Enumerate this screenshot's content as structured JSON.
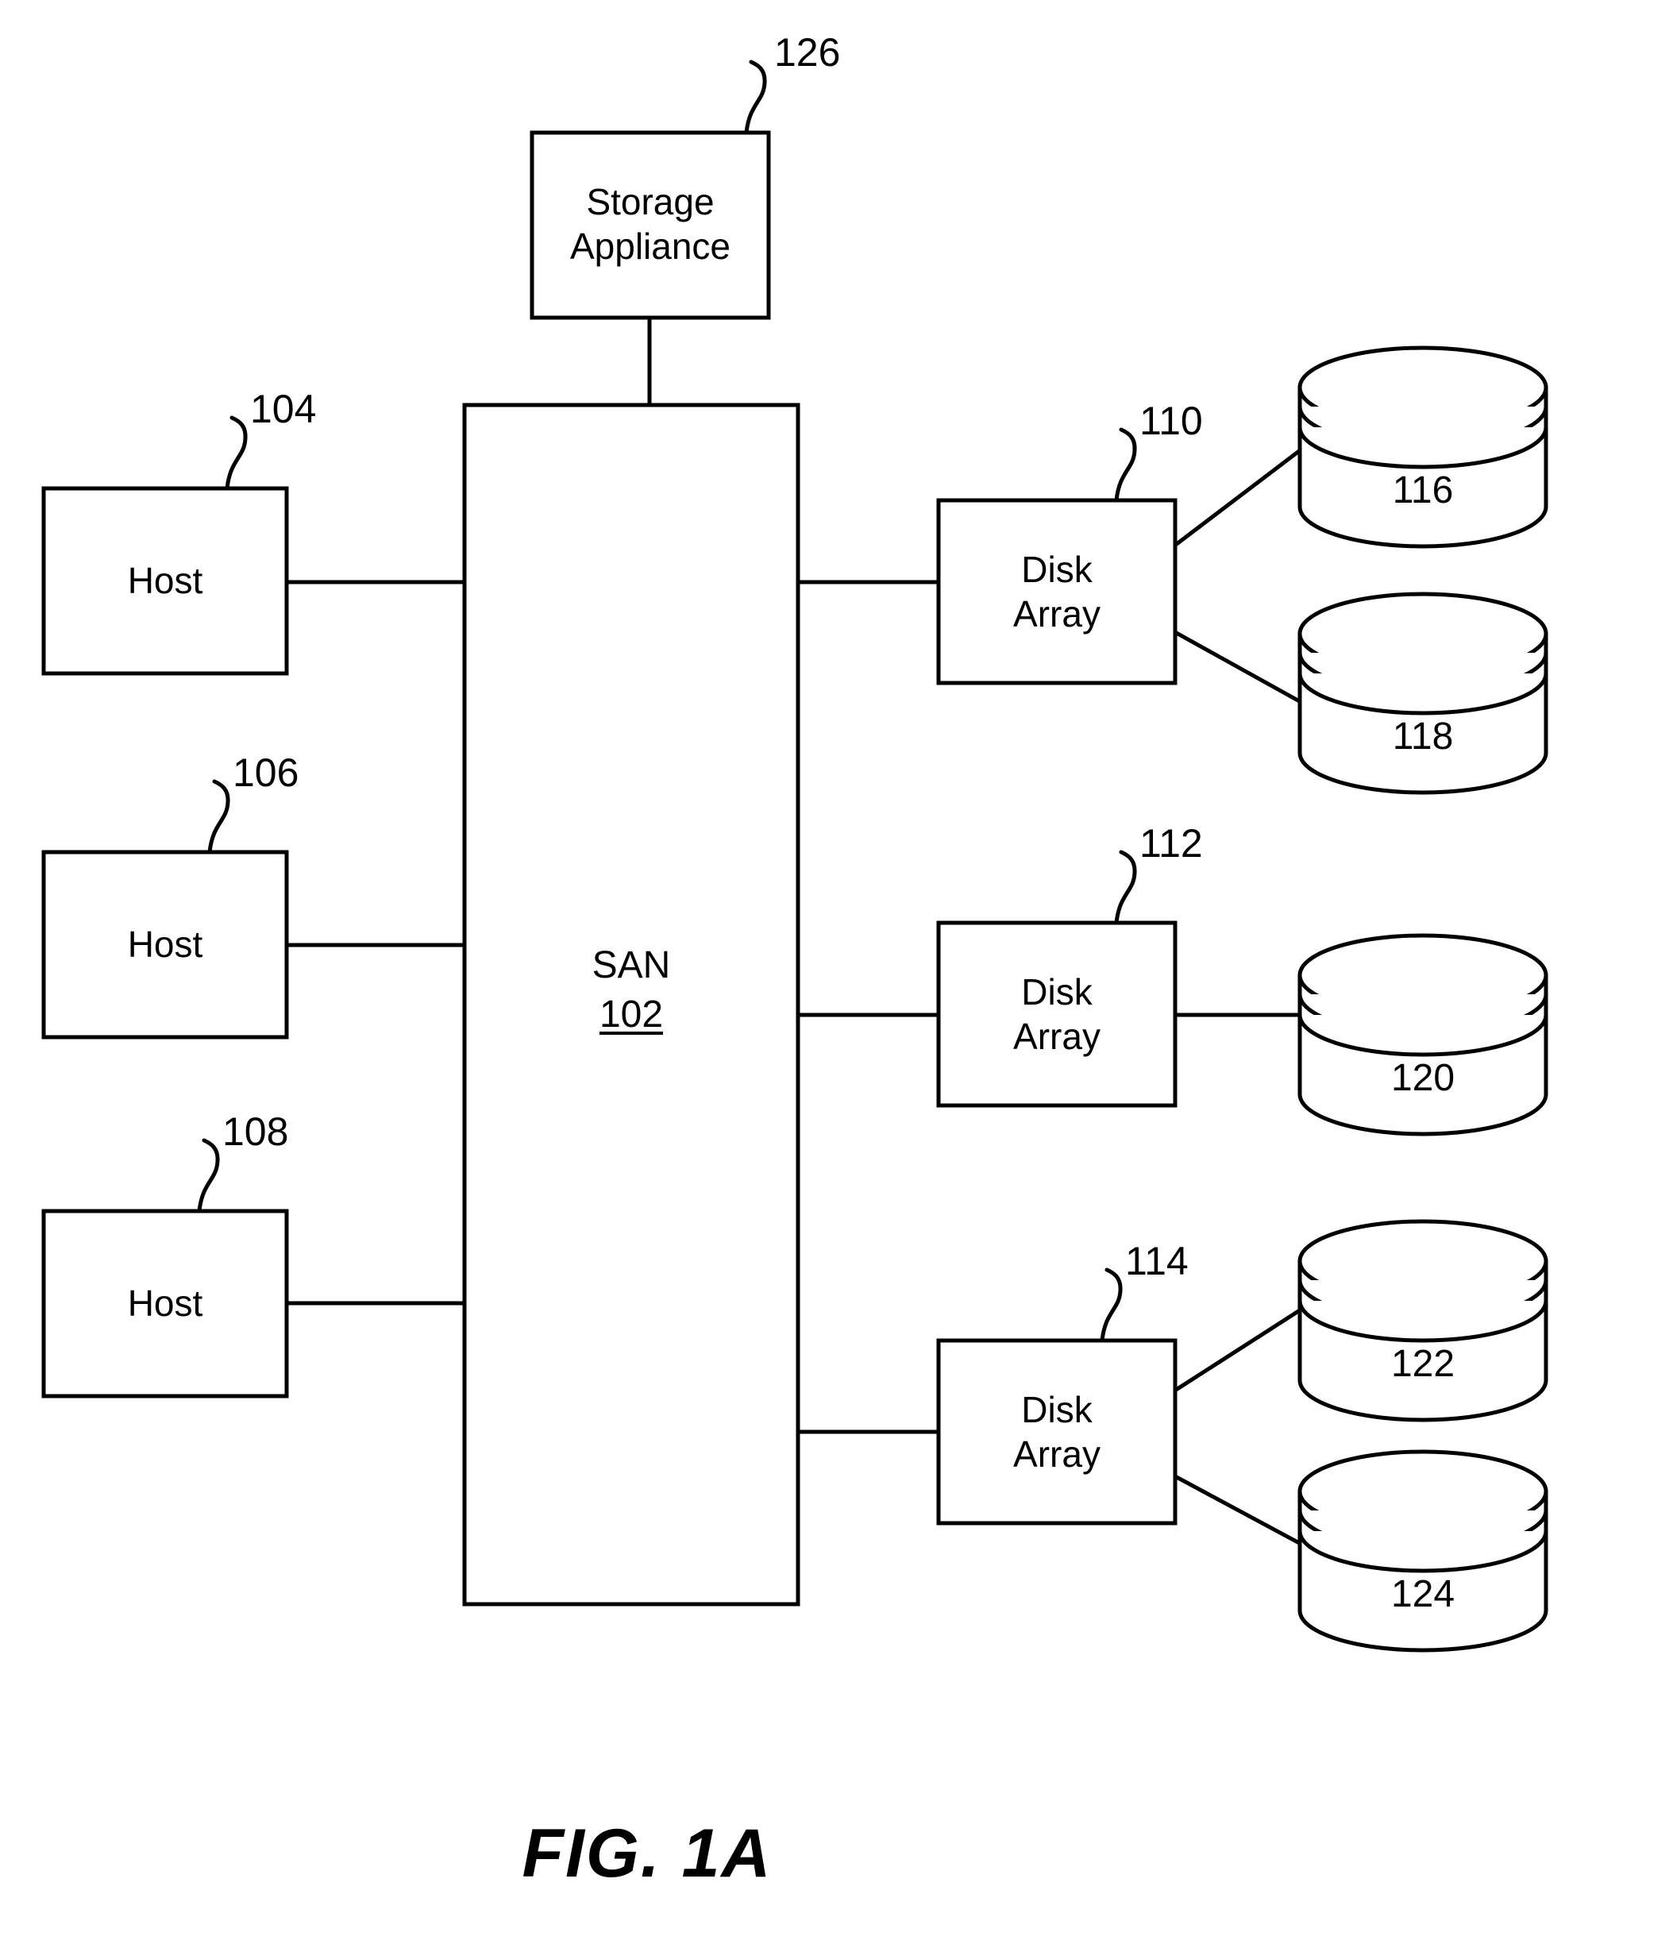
{
  "figure": {
    "caption": "FIG. 1A",
    "line_color": "#000000",
    "background_color": "#ffffff"
  },
  "nodes": {
    "storage_appliance": {
      "label": "Storage\nAppliance",
      "ref": "126"
    },
    "san": {
      "label": "SAN",
      "ref": "102"
    },
    "host_104": {
      "label": "Host",
      "ref": "104"
    },
    "host_106": {
      "label": "Host",
      "ref": "106"
    },
    "host_108": {
      "label": "Host",
      "ref": "108"
    },
    "disk_array_110": {
      "label": "Disk\nArray",
      "ref": "110"
    },
    "disk_array_112": {
      "label": "Disk\nArray",
      "ref": "112"
    },
    "disk_array_114": {
      "label": "Disk\nArray",
      "ref": "114"
    },
    "disk_116": {
      "label": "116"
    },
    "disk_118": {
      "label": "118"
    },
    "disk_120": {
      "label": "120"
    },
    "disk_122": {
      "label": "122"
    },
    "disk_124": {
      "label": "124"
    }
  }
}
